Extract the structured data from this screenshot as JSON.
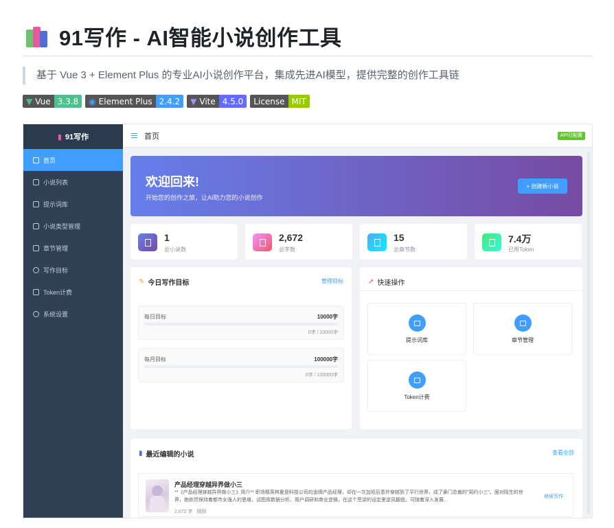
{
  "readme": {
    "title": "91写作 - AI智能小说创作工具",
    "description": "基于 Vue 3 + Element Plus 的专业AI小说创作平台，集成先进AI模型，提供完整的创作工具链",
    "badges": [
      {
        "label": "Vue",
        "value": "3.3.8",
        "color": "#4fc08d"
      },
      {
        "label": "Element Plus",
        "value": "2.4.2",
        "color": "#409eff"
      },
      {
        "label": "Vite",
        "value": "4.5.0",
        "color": "#646cff"
      },
      {
        "label": "License",
        "value": "MIT",
        "color": "#97ca00"
      }
    ]
  },
  "app": {
    "logo": "91写作",
    "sidebar": [
      {
        "label": "首页",
        "icon": "home-icon"
      },
      {
        "label": "小说列表",
        "icon": "document-icon"
      },
      {
        "label": "提示词库",
        "icon": "chat-icon"
      },
      {
        "label": "小说类型管理",
        "icon": "folder-icon"
      },
      {
        "label": "章节管理",
        "icon": "book-icon"
      },
      {
        "label": "写作目标",
        "icon": "target-icon"
      },
      {
        "label": "Token计费",
        "icon": "card-icon"
      },
      {
        "label": "系统设置",
        "icon": "gear-icon"
      }
    ],
    "topbar": {
      "page": "首页",
      "api_status": "API已配置"
    },
    "hero": {
      "title": "欢迎回来!",
      "subtitle": "开始您的创作之旅，让AI助力您的小说创作",
      "button": "+ 创建新小说"
    },
    "stats": [
      {
        "value": "1",
        "label": "总小说数",
        "color": "#6a5acd"
      },
      {
        "value": "2,672",
        "label": "总字数",
        "color": "#f063b6"
      },
      {
        "value": "15",
        "label": "总章节数",
        "color": "#22b8f0"
      },
      {
        "value": "7.4万",
        "label": "已用Token",
        "color": "#3dd5a0"
      }
    ],
    "goals": {
      "title": "今日写作目标",
      "link": "管理目标",
      "items": [
        {
          "name": "每日目标",
          "target": "10000字",
          "progress": "0字 / 10000字"
        },
        {
          "name": "每月目标",
          "target": "100000字",
          "progress": "0字 / 100000字"
        }
      ]
    },
    "quick": {
      "title": "快速操作",
      "items": [
        {
          "label": "提示词库"
        },
        {
          "label": "章节管理"
        },
        {
          "label": "Token计费"
        }
      ]
    },
    "recent": {
      "title": "最近编辑的小说",
      "link": "查看全部",
      "novel": {
        "title": "产品经理穿越异界做小三",
        "desc": "**《产品经理穿越异界做小三》简介** 职场精英林夏是科技公司的金牌产品经理，却在一次加班后意外穿越到了平行世界，成了豪门总裁的\"契约小三\"。面对陌生的世界，她依然保持着都市女强人的思维，试图用数据分析、用户调研和商业逻辑，在这个荒谬的设定里逆风翻盘。可随着深入发展...",
        "words": "2,672 字",
        "time": "刚刚",
        "action": "继续写作"
      }
    }
  }
}
